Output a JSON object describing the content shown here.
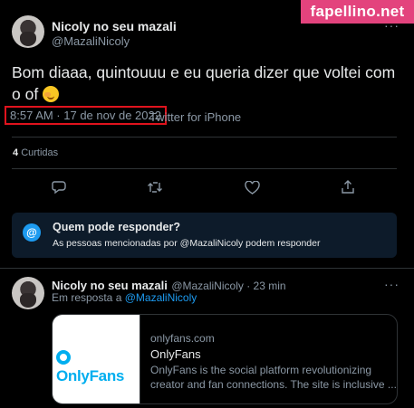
{
  "watermark": "fapellino.net",
  "tweet": {
    "name": "Nicoly no seu mazali",
    "handle": "@MazaliNicoly",
    "text_line1": "Bom diaaa, quintouuu e eu queria dizer que voltei com",
    "text_line2": "o of",
    "emoji": "face-with-hand-over-mouth",
    "datetime": "8:57 AM · 17 de nov de 2022",
    "source": "Twitter for iPhone",
    "likes_count": "4",
    "likes_label": "Curtidas"
  },
  "reply_restriction": {
    "title": "Quem pode responder?",
    "description": "As pessoas mencionadas por @MazaliNicoly podem responder"
  },
  "reply": {
    "name": "Nicoly no seu mazali",
    "handle_time": "@MazaliNicoly · 23 min",
    "in_reply_prefix": "Em resposta a",
    "in_reply_handle": "@MazaliNicoly",
    "card": {
      "domain": "onlyfans.com",
      "title": "OnlyFans",
      "desc_line1": "OnlyFans is the social platform revolutionizing",
      "desc_line2": "creator and fan connections. The site is inclusive ...",
      "logo_text": "OnlyFans"
    }
  },
  "icons": [
    "more-icon",
    "reply-icon",
    "retweet-icon",
    "like-icon",
    "share-icon",
    "at-icon"
  ],
  "colors": {
    "accent": "#1d9bf0",
    "highlight": "#e0131d",
    "watermark_bg": "#e3437d"
  }
}
